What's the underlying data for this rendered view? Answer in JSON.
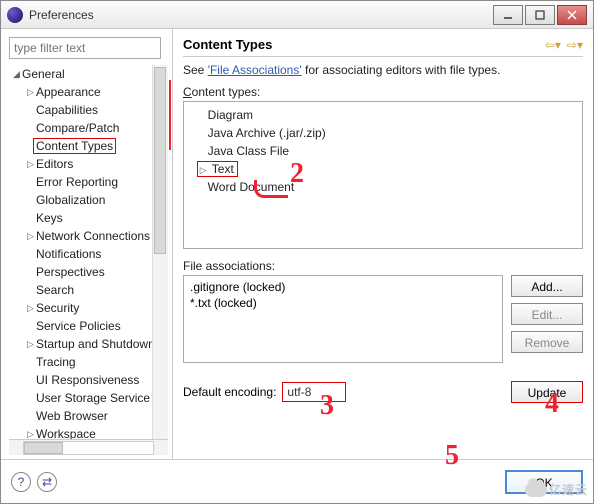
{
  "window": {
    "title": "Preferences"
  },
  "filter": {
    "placeholder": "type filter text"
  },
  "tree": {
    "root": "General",
    "items": [
      {
        "label": "Appearance",
        "exp": true
      },
      {
        "label": "Capabilities",
        "exp": false
      },
      {
        "label": "Compare/Patch",
        "exp": false
      },
      {
        "label": "Content Types",
        "exp": false,
        "selected": true
      },
      {
        "label": "Editors",
        "exp": true
      },
      {
        "label": "Error Reporting",
        "exp": false
      },
      {
        "label": "Globalization",
        "exp": false
      },
      {
        "label": "Keys",
        "exp": false
      },
      {
        "label": "Network Connections",
        "exp": true
      },
      {
        "label": "Notifications",
        "exp": false
      },
      {
        "label": "Perspectives",
        "exp": false
      },
      {
        "label": "Search",
        "exp": false
      },
      {
        "label": "Security",
        "exp": true
      },
      {
        "label": "Service Policies",
        "exp": false
      },
      {
        "label": "Startup and Shutdown",
        "exp": true
      },
      {
        "label": "Tracing",
        "exp": false
      },
      {
        "label": "UI Responsiveness",
        "exp": false
      },
      {
        "label": "User Storage Service",
        "exp": false
      },
      {
        "label": "Web Browser",
        "exp": false
      },
      {
        "label": "Workspace",
        "exp": true
      }
    ]
  },
  "right": {
    "heading": "Content Types",
    "intro_pre": "See ",
    "intro_link": "'File Associations'",
    "intro_post": " for associating editors with file types.",
    "ct_label": "Content types:",
    "content_types": [
      {
        "label": "Diagram",
        "exp": false
      },
      {
        "label": "Java Archive (.jar/.zip)",
        "exp": false
      },
      {
        "label": "Java Class File",
        "exp": false
      },
      {
        "label": "Text",
        "exp": true,
        "selected": true
      },
      {
        "label": "Word Document",
        "exp": false
      }
    ],
    "fa_label": "File associations:",
    "file_assoc": [
      ".gitignore (locked)",
      "*.txt (locked)"
    ],
    "buttons": {
      "add": "Add...",
      "edit": "Edit...",
      "remove": "Remove",
      "update": "Update"
    },
    "enc_label": "Default encoding:",
    "enc_value": "utf-8"
  },
  "footer": {
    "ok": "OK"
  },
  "annotations": {
    "n2": "2",
    "n3": "3",
    "n4": "4",
    "n5": "5"
  },
  "watermark": "亿速云"
}
